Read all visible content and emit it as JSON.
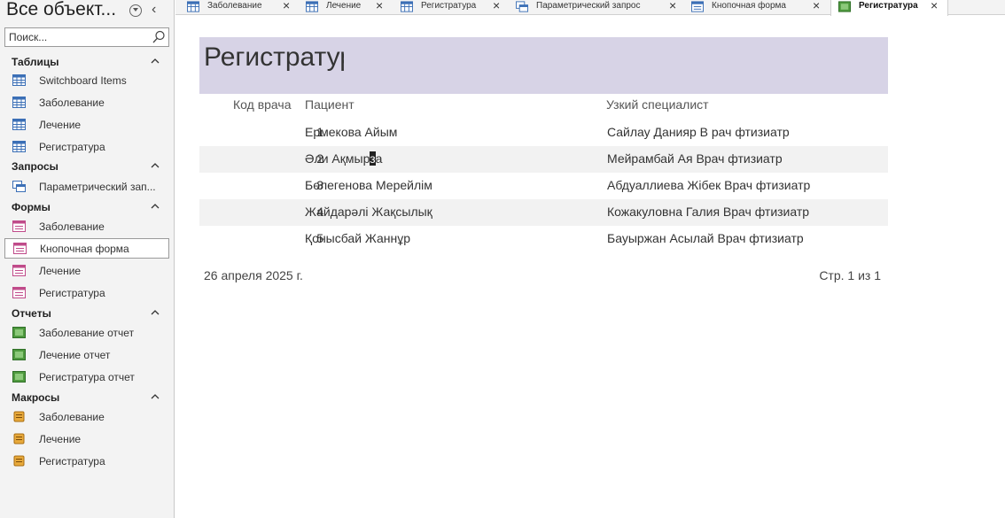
{
  "nav": {
    "title": "Все объект...",
    "search_placeholder": "Поиск...",
    "groups": [
      {
        "label": "Таблицы",
        "items": [
          {
            "label": "Switchboard Items"
          },
          {
            "label": "Заболевание"
          },
          {
            "label": "Лечение"
          },
          {
            "label": "Регистратура"
          }
        ]
      },
      {
        "label": "Запросы",
        "items": [
          {
            "label": "Параметрический зап..."
          }
        ]
      },
      {
        "label": "Формы",
        "items": [
          {
            "label": "Заболевание"
          },
          {
            "label": "Кнопочная форма"
          },
          {
            "label": "Лечение"
          },
          {
            "label": "Регистратура"
          }
        ]
      },
      {
        "label": "Отчеты",
        "items": [
          {
            "label": "Заболевание отчет"
          },
          {
            "label": "Лечение отчет"
          },
          {
            "label": "Регистратура отчет"
          }
        ]
      },
      {
        "label": "Макросы",
        "items": [
          {
            "label": "Заболевание"
          },
          {
            "label": "Лечение"
          },
          {
            "label": "Регистратура"
          }
        ]
      }
    ]
  },
  "tabs": [
    {
      "label": "Заболевание",
      "icon": "table-icon"
    },
    {
      "label": "Лечение",
      "icon": "table-icon"
    },
    {
      "label": "Регистратура",
      "icon": "table-icon"
    },
    {
      "label": "Параметрический запрос",
      "icon": "query-icon"
    },
    {
      "label": "Кнопочная форма",
      "icon": "form-icon"
    },
    {
      "label": "Регистратура",
      "icon": "report-icon",
      "active": true
    }
  ],
  "report": {
    "title": "Регистратура",
    "columns": {
      "id": "Код врача",
      "patient": "Пациент",
      "specialist": "Узкий специалист"
    },
    "rows": [
      {
        "id": "1",
        "patient": "Ермекова Айым",
        "specialist": "Сайлау Данияр В рач фтизиатр"
      },
      {
        "id": "2",
        "patient_before": "Әли Ақмыр",
        "patient_cursor": "з",
        "patient_after": "а",
        "specialist": "Мейрамбай Ая Врач фтизиатр"
      },
      {
        "id": "3",
        "patient": "Бөлегенова Мерейлім",
        "specialist": "Абдуаллиева Жібек Врач фтизиатр"
      },
      {
        "id": "4",
        "patient": "Жайдарәлі Жақсылық",
        "specialist": "Кожакуловна Галия Врач фтизиатр"
      },
      {
        "id": "5",
        "patient": "Қонысбай Жаннұр",
        "specialist": "Бауыржан Асылай Врач фтизиатр"
      }
    ],
    "date": "26 апреля 2025 г.",
    "page_info": "Стр. 1 из 1"
  },
  "colors": {
    "title_band": "#d7d3e6",
    "alt_row": "#f2f2f2",
    "nav_bg": "#f3f3f3"
  }
}
